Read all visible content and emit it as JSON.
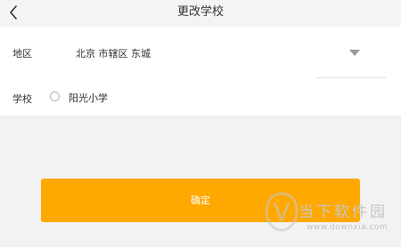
{
  "header": {
    "title": "更改学校",
    "back_icon": "chevron-left-icon"
  },
  "form": {
    "region_label": "地区",
    "region_value": "北京 市辖区 东城",
    "dropdown_icon": "triangle-down-icon",
    "school_label": "学校",
    "school_option": "阳光小学",
    "school_selected": false
  },
  "confirm": {
    "label": "确定"
  },
  "watermark": {
    "text": "当下软件园",
    "url": "www.downxia.com",
    "logo_icon": "downxia-logo"
  },
  "colors": {
    "accent": "#ffa800",
    "background": "#f2f2f2",
    "card": "#ffffff"
  }
}
